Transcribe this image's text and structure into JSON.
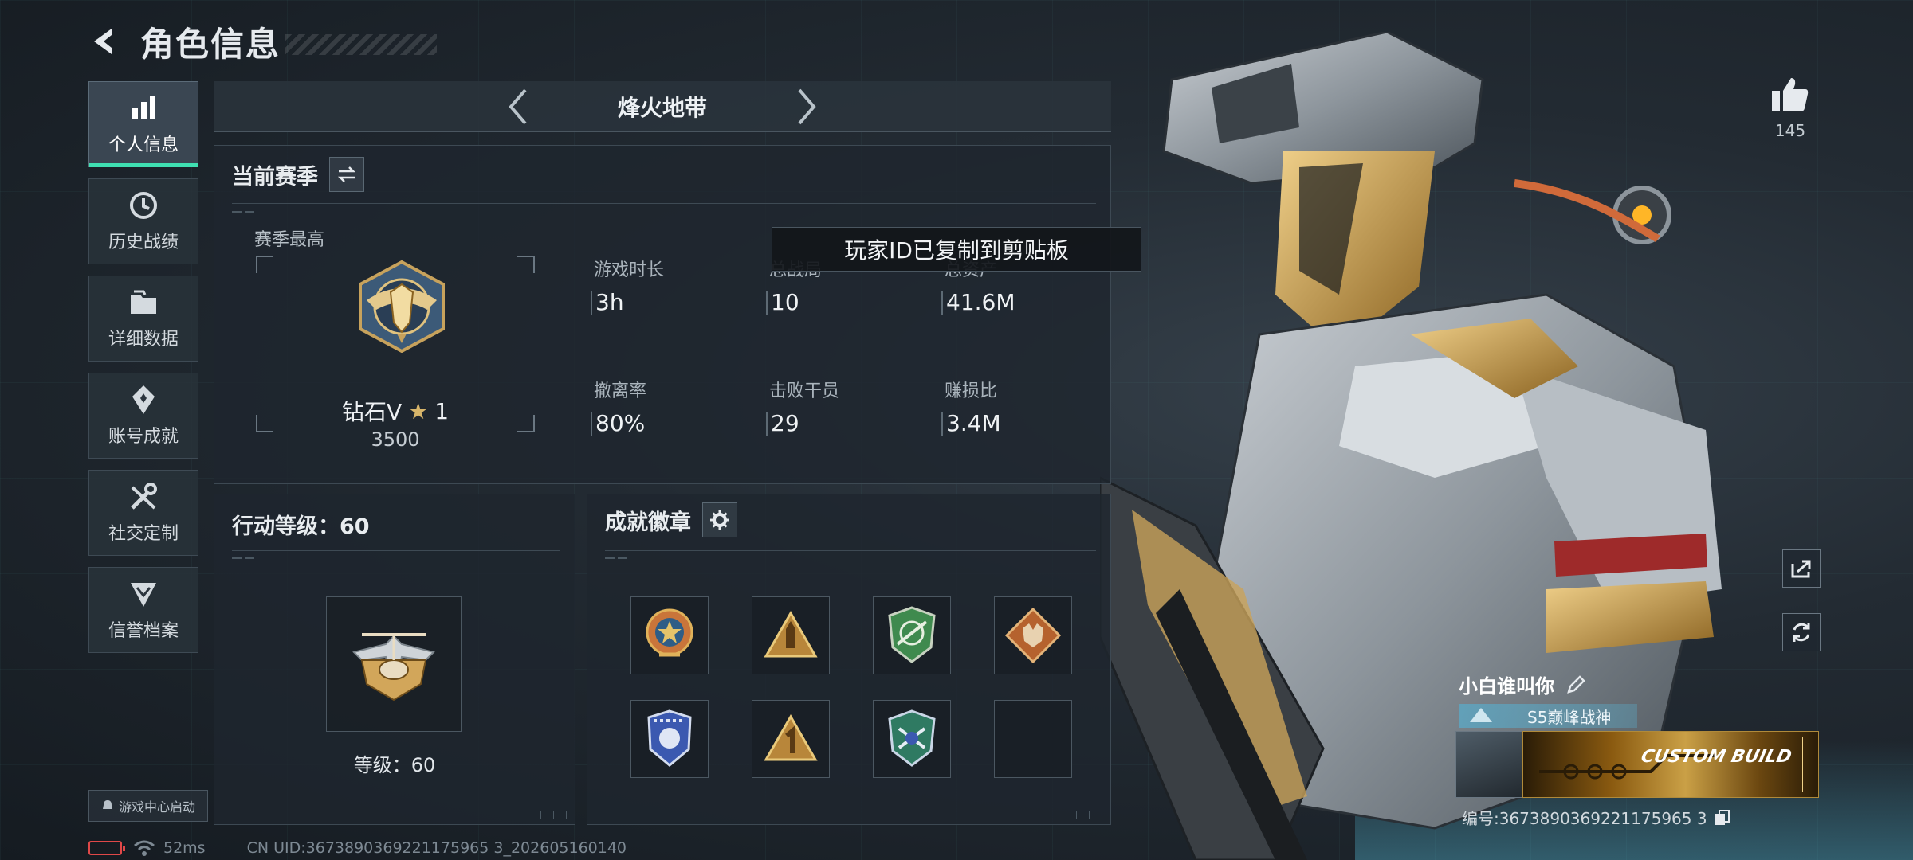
{
  "header": {
    "title": "角色信息"
  },
  "sidebar": {
    "items": [
      {
        "label": "个人信息",
        "icon": "bar-chart-icon",
        "active": true
      },
      {
        "label": "历史战绩",
        "icon": "history-clock-icon",
        "active": false
      },
      {
        "label": "详细数据",
        "icon": "folder-icon",
        "active": false
      },
      {
        "label": "账号成就",
        "icon": "achievement-medal-icon",
        "active": false
      },
      {
        "label": "社交定制",
        "icon": "tools-icon",
        "active": false
      },
      {
        "label": "信誉档案",
        "icon": "shield-chevron-icon",
        "active": false
      }
    ],
    "game_center": "游戏中心启动"
  },
  "mode_selector": {
    "name": "烽火地带"
  },
  "season": {
    "title": "当前赛季",
    "best_label": "赛季最高",
    "rank_name": "钻石V",
    "rank_stars": "1",
    "rank_score": "3500",
    "stats": [
      {
        "label": "游戏时长",
        "value": "3h"
      },
      {
        "label": "总战局",
        "value": "10"
      },
      {
        "label": "总资产",
        "value": "41.6M"
      },
      {
        "label": "撤离率",
        "value": "80%"
      },
      {
        "label": "击败干员",
        "value": "29"
      },
      {
        "label": "赚损比",
        "value": "3.4M"
      }
    ]
  },
  "toast": {
    "text": "玩家ID已复制到剪贴板"
  },
  "action_level": {
    "title": "行动等级：60",
    "level_text": "等级：60"
  },
  "achievements": {
    "title": "成就徽章",
    "badges": [
      {
        "icon": "star-wreath-badge-icon",
        "color": "#c9753a"
      },
      {
        "icon": "bullet-triangle-badge-icon",
        "color": "#b8863a"
      },
      {
        "icon": "rifle-shield-badge-icon",
        "color": "#3f8a4e"
      },
      {
        "icon": "wolf-diamond-badge-icon",
        "color": "#b5622e"
      },
      {
        "icon": "eagle-shield-badge-icon",
        "color": "#3b59b0"
      },
      {
        "icon": "number-one-triangle-badge-icon",
        "color": "#b8863a"
      },
      {
        "icon": "crossed-guns-shield-badge-icon",
        "color": "#2f7a62"
      },
      {
        "icon": "empty-slot",
        "color": ""
      }
    ]
  },
  "status_bar": {
    "ping": "52ms",
    "uid": "CN UID:3673890369221175965 3_202605160140"
  },
  "profile": {
    "likes": "145",
    "player_name": "小白谁叫你",
    "title_tag": "S5巅峰战神",
    "nameplate_text": "CUSTOM BUILD",
    "player_id": "编号:3673890369221175965 3"
  },
  "colors": {
    "accent": "#3fe0b2",
    "gold": "#d7b56a",
    "panel": "#1e262e"
  }
}
